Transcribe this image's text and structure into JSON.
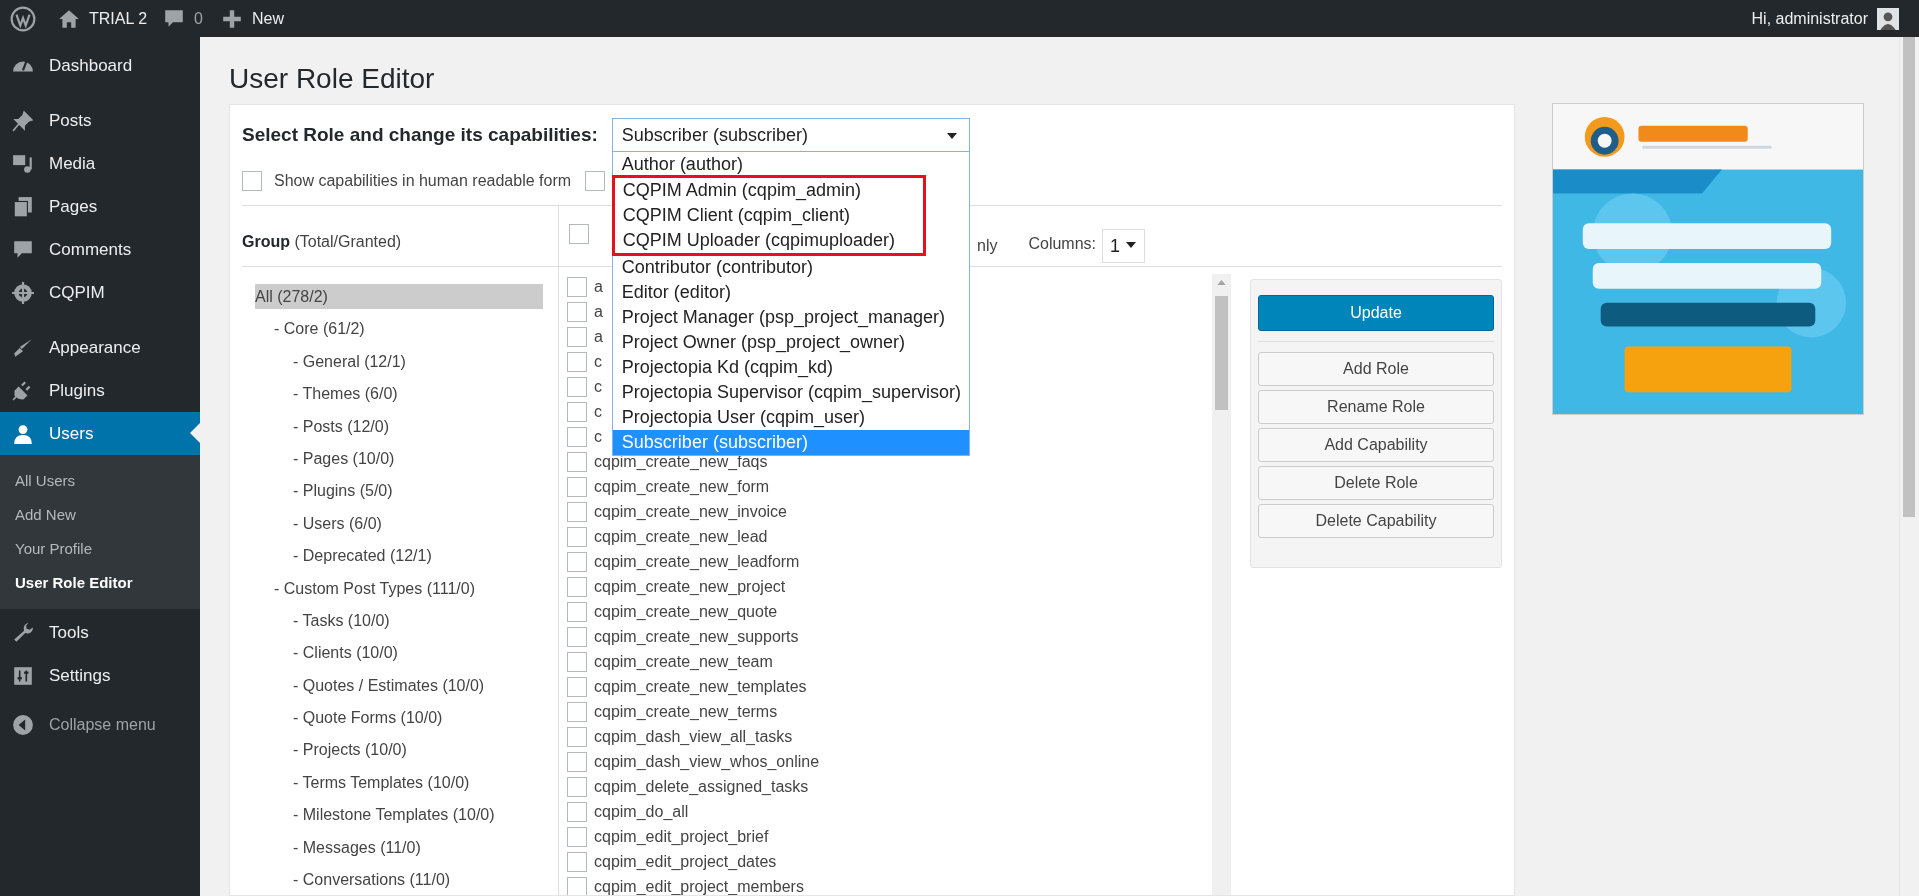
{
  "admin_bar": {
    "site_name": "TRIAL 2",
    "comments_count": "0",
    "new_label": "New",
    "greeting": "Hi, administrator"
  },
  "sidebar": {
    "sections": [
      {
        "items": [
          {
            "label": "Dashboard",
            "selected": false
          }
        ]
      },
      {
        "items": [
          {
            "label": "Posts",
            "selected": false
          },
          {
            "label": "Media",
            "selected": false
          },
          {
            "label": "Pages",
            "selected": false
          },
          {
            "label": "Comments",
            "selected": false
          },
          {
            "label": "CQPIM",
            "selected": false
          }
        ]
      },
      {
        "items": [
          {
            "label": "Appearance",
            "selected": false
          },
          {
            "label": "Plugins",
            "selected": false
          },
          {
            "label": "Users",
            "selected": true,
            "submenu": [
              {
                "label": "All Users",
                "selected": false
              },
              {
                "label": "Add New",
                "selected": false
              },
              {
                "label": "Your Profile",
                "selected": false
              },
              {
                "label": "User Role Editor",
                "selected": true
              }
            ]
          },
          {
            "label": "Tools",
            "selected": false
          },
          {
            "label": "Settings",
            "selected": false
          }
        ]
      }
    ],
    "collapse_label": "Collapse menu"
  },
  "page_title": "User Role Editor",
  "role_select": {
    "label": "Select Role and change its capabilities:",
    "value": "Subscriber (subscriber)",
    "expanded": true,
    "options": [
      {
        "label": "Author (author)",
        "selected": false,
        "highlighted": false
      },
      {
        "label": "CQPIM Admin (cqpim_admin)",
        "selected": false,
        "highlighted": true
      },
      {
        "label": "CQPIM Client (cqpim_client)",
        "selected": false,
        "highlighted": true
      },
      {
        "label": "CQPIM Uploader (cqpimuploader)",
        "selected": false,
        "highlighted": true
      },
      {
        "label": "Contributor (contributor)",
        "selected": false,
        "highlighted": false
      },
      {
        "label": "Editor (editor)",
        "selected": false,
        "highlighted": false
      },
      {
        "label": "Project Manager (psp_project_manager)",
        "selected": false,
        "highlighted": false
      },
      {
        "label": "Project Owner (psp_project_owner)",
        "selected": false,
        "highlighted": false
      },
      {
        "label": "Projectopia Kd (cqpim_kd)",
        "selected": false,
        "highlighted": false
      },
      {
        "label": "Projectopia Supervisor (cqpim_supervisor)",
        "selected": false,
        "highlighted": false
      },
      {
        "label": "Projectopia User (cqpim_user)",
        "selected": false,
        "highlighted": false
      },
      {
        "label": "Subscriber (subscriber)",
        "selected": true,
        "highlighted": false
      }
    ]
  },
  "options_row": {
    "checkboxes": [
      {
        "label": "Show capabilities in human readable form",
        "checked": false
      },
      {
        "checked": false
      }
    ]
  },
  "group_panel": {
    "heading": "Group",
    "heading_note": "(Total/Granted)",
    "tree": [
      {
        "label": "All (278/2)",
        "selected": true,
        "children": [
          {
            "label": "- Core (61/2)",
            "selected": false,
            "children": [
              {
                "label": "- General (12/1)",
                "selected": false
              },
              {
                "label": "- Themes (6/0)",
                "selected": false
              },
              {
                "label": "- Posts (12/0)",
                "selected": false
              },
              {
                "label": "- Pages (10/0)",
                "selected": false
              },
              {
                "label": "- Plugins (5/0)",
                "selected": false
              },
              {
                "label": "- Users (6/0)",
                "selected": false
              },
              {
                "label": "- Deprecated (12/1)",
                "selected": false
              }
            ]
          },
          {
            "label": "- Custom Post Types (111/0)",
            "selected": false,
            "children": [
              {
                "label": "- Tasks (10/0)",
                "selected": false
              },
              {
                "label": "- Clients (10/0)",
                "selected": false
              },
              {
                "label": "- Quotes / Estimates (10/0)",
                "selected": false
              },
              {
                "label": "- Quote Forms (10/0)",
                "selected": false
              },
              {
                "label": "- Projects (10/0)",
                "selected": false
              },
              {
                "label": "- Terms Templates (10/0)",
                "selected": false
              },
              {
                "label": "- Milestone Templates (10/0)",
                "selected": false
              },
              {
                "label": "- Messages (11/0)",
                "selected": false
              },
              {
                "label": "- Conversations (11/0)",
                "selected": false
              }
            ]
          }
        ]
      }
    ]
  },
  "capabilities": {
    "select_all_checked": false,
    "filter_label": "nly",
    "columns_label": "Columns:",
    "columns_value": "1",
    "items": [
      {
        "label": "a",
        "checked": false
      },
      {
        "label": "a",
        "checked": false
      },
      {
        "label": "a",
        "checked": false
      },
      {
        "label": "c",
        "checked": false
      },
      {
        "label": "c",
        "checked": false
      },
      {
        "label": "c",
        "checked": false
      },
      {
        "label": "c",
        "checked": false
      },
      {
        "label": "cqpim_create_new_faqs",
        "checked": false
      },
      {
        "label": "cqpim_create_new_form",
        "checked": false
      },
      {
        "label": "cqpim_create_new_invoice",
        "checked": false
      },
      {
        "label": "cqpim_create_new_lead",
        "checked": false
      },
      {
        "label": "cqpim_create_new_leadform",
        "checked": false
      },
      {
        "label": "cqpim_create_new_project",
        "checked": false
      },
      {
        "label": "cqpim_create_new_quote",
        "checked": false
      },
      {
        "label": "cqpim_create_new_supports",
        "checked": false
      },
      {
        "label": "cqpim_create_new_team",
        "checked": false
      },
      {
        "label": "cqpim_create_new_templates",
        "checked": false
      },
      {
        "label": "cqpim_create_new_terms",
        "checked": false
      },
      {
        "label": "cqpim_dash_view_all_tasks",
        "checked": false
      },
      {
        "label": "cqpim_dash_view_whos_online",
        "checked": false
      },
      {
        "label": "cqpim_delete_assigned_tasks",
        "checked": false
      },
      {
        "label": "cqpim_do_all",
        "checked": false
      },
      {
        "label": "cqpim_edit_project_brief",
        "checked": false
      },
      {
        "label": "cqpim_edit_project_dates",
        "checked": false
      },
      {
        "label": "cqpim_edit_project_members",
        "checked": false
      }
    ]
  },
  "actions": {
    "primary": "Update",
    "buttons": [
      "Add Role",
      "Rename Role",
      "Add Capability",
      "Delete Role",
      "Delete Capability"
    ]
  }
}
